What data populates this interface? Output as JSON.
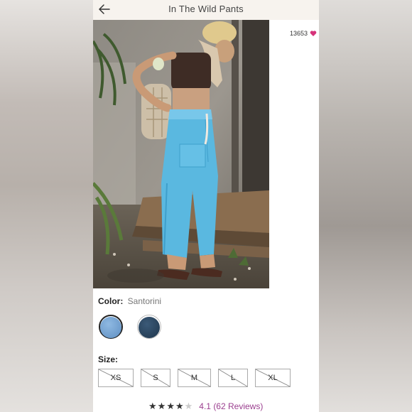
{
  "header": {
    "title": "In The Wild Pants"
  },
  "product": {
    "likes": "13653",
    "color_label": "Color:",
    "color_value": "Santorini",
    "swatches": [
      {
        "name": "Santorini",
        "color": "#6f9fd0",
        "selected": true
      },
      {
        "name": "Navy",
        "color": "#27425c",
        "selected": false
      }
    ],
    "size_label": "Size:",
    "sizes": [
      "XS",
      "S",
      "M",
      "L",
      "XL"
    ],
    "sizes_unavailable": true,
    "rating_value": "4.1",
    "reviews_text": "(62 Reviews)",
    "stars_filled": 4,
    "stars_total": 5
  },
  "colors": {
    "accent": "#9b3f8f",
    "heart": "#d6337a",
    "pants": "#5ab8e0",
    "topbar": "#f7f3ee"
  },
  "icons": {
    "back": "arrow-left-icon",
    "like": "heart-icon",
    "star": "star-icon"
  }
}
